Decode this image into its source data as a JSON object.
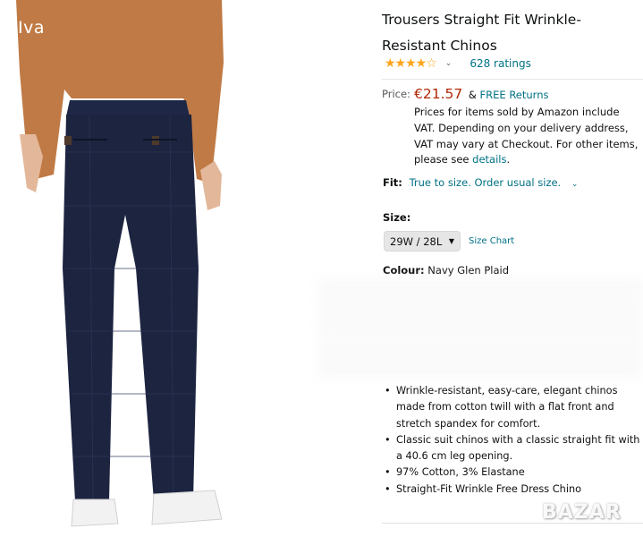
{
  "photo": {
    "watermark": "Iva"
  },
  "product": {
    "title": "Trousers Straight Fit Wrinkle-Resistant Chinos",
    "rating_stars": "★★★★☆",
    "rating_count_link": "628 ratings",
    "rating_value": 4.2
  },
  "price": {
    "label": "Price:",
    "value": "€21.57",
    "amp": "&",
    "returns": "FREE Returns",
    "note_text": "Prices for items sold by Amazon include VAT. Depending on your delivery address, VAT may vary at Checkout. For other items, please see ",
    "note_link": "details",
    "note_end": "."
  },
  "fit": {
    "label": "Fit:",
    "value": "True to size. Order usual size."
  },
  "size": {
    "label": "Size:",
    "selected": "29W / 28L",
    "chart_link": "Size Chart"
  },
  "colour": {
    "label": "Colour:",
    "value": "Navy Glen Plaid"
  },
  "bullets": [
    "Wrinkle-resistant, easy-care, elegant chinos made from cotton twill with a flat front and stretch spandex for comfort.",
    "Classic suit chinos with a classic straight fit with a 40.6 cm leg opening.",
    "97% Cotton, 3% Elastane",
    "Straight-Fit Wrinkle Free Dress Chino"
  ],
  "brand_logo": "BAZAR",
  "colors": {
    "link": "#007185",
    "price": "#b12704",
    "star": "#ffa41c",
    "trousers": "#1c2440",
    "sweater": "#c07a45"
  }
}
